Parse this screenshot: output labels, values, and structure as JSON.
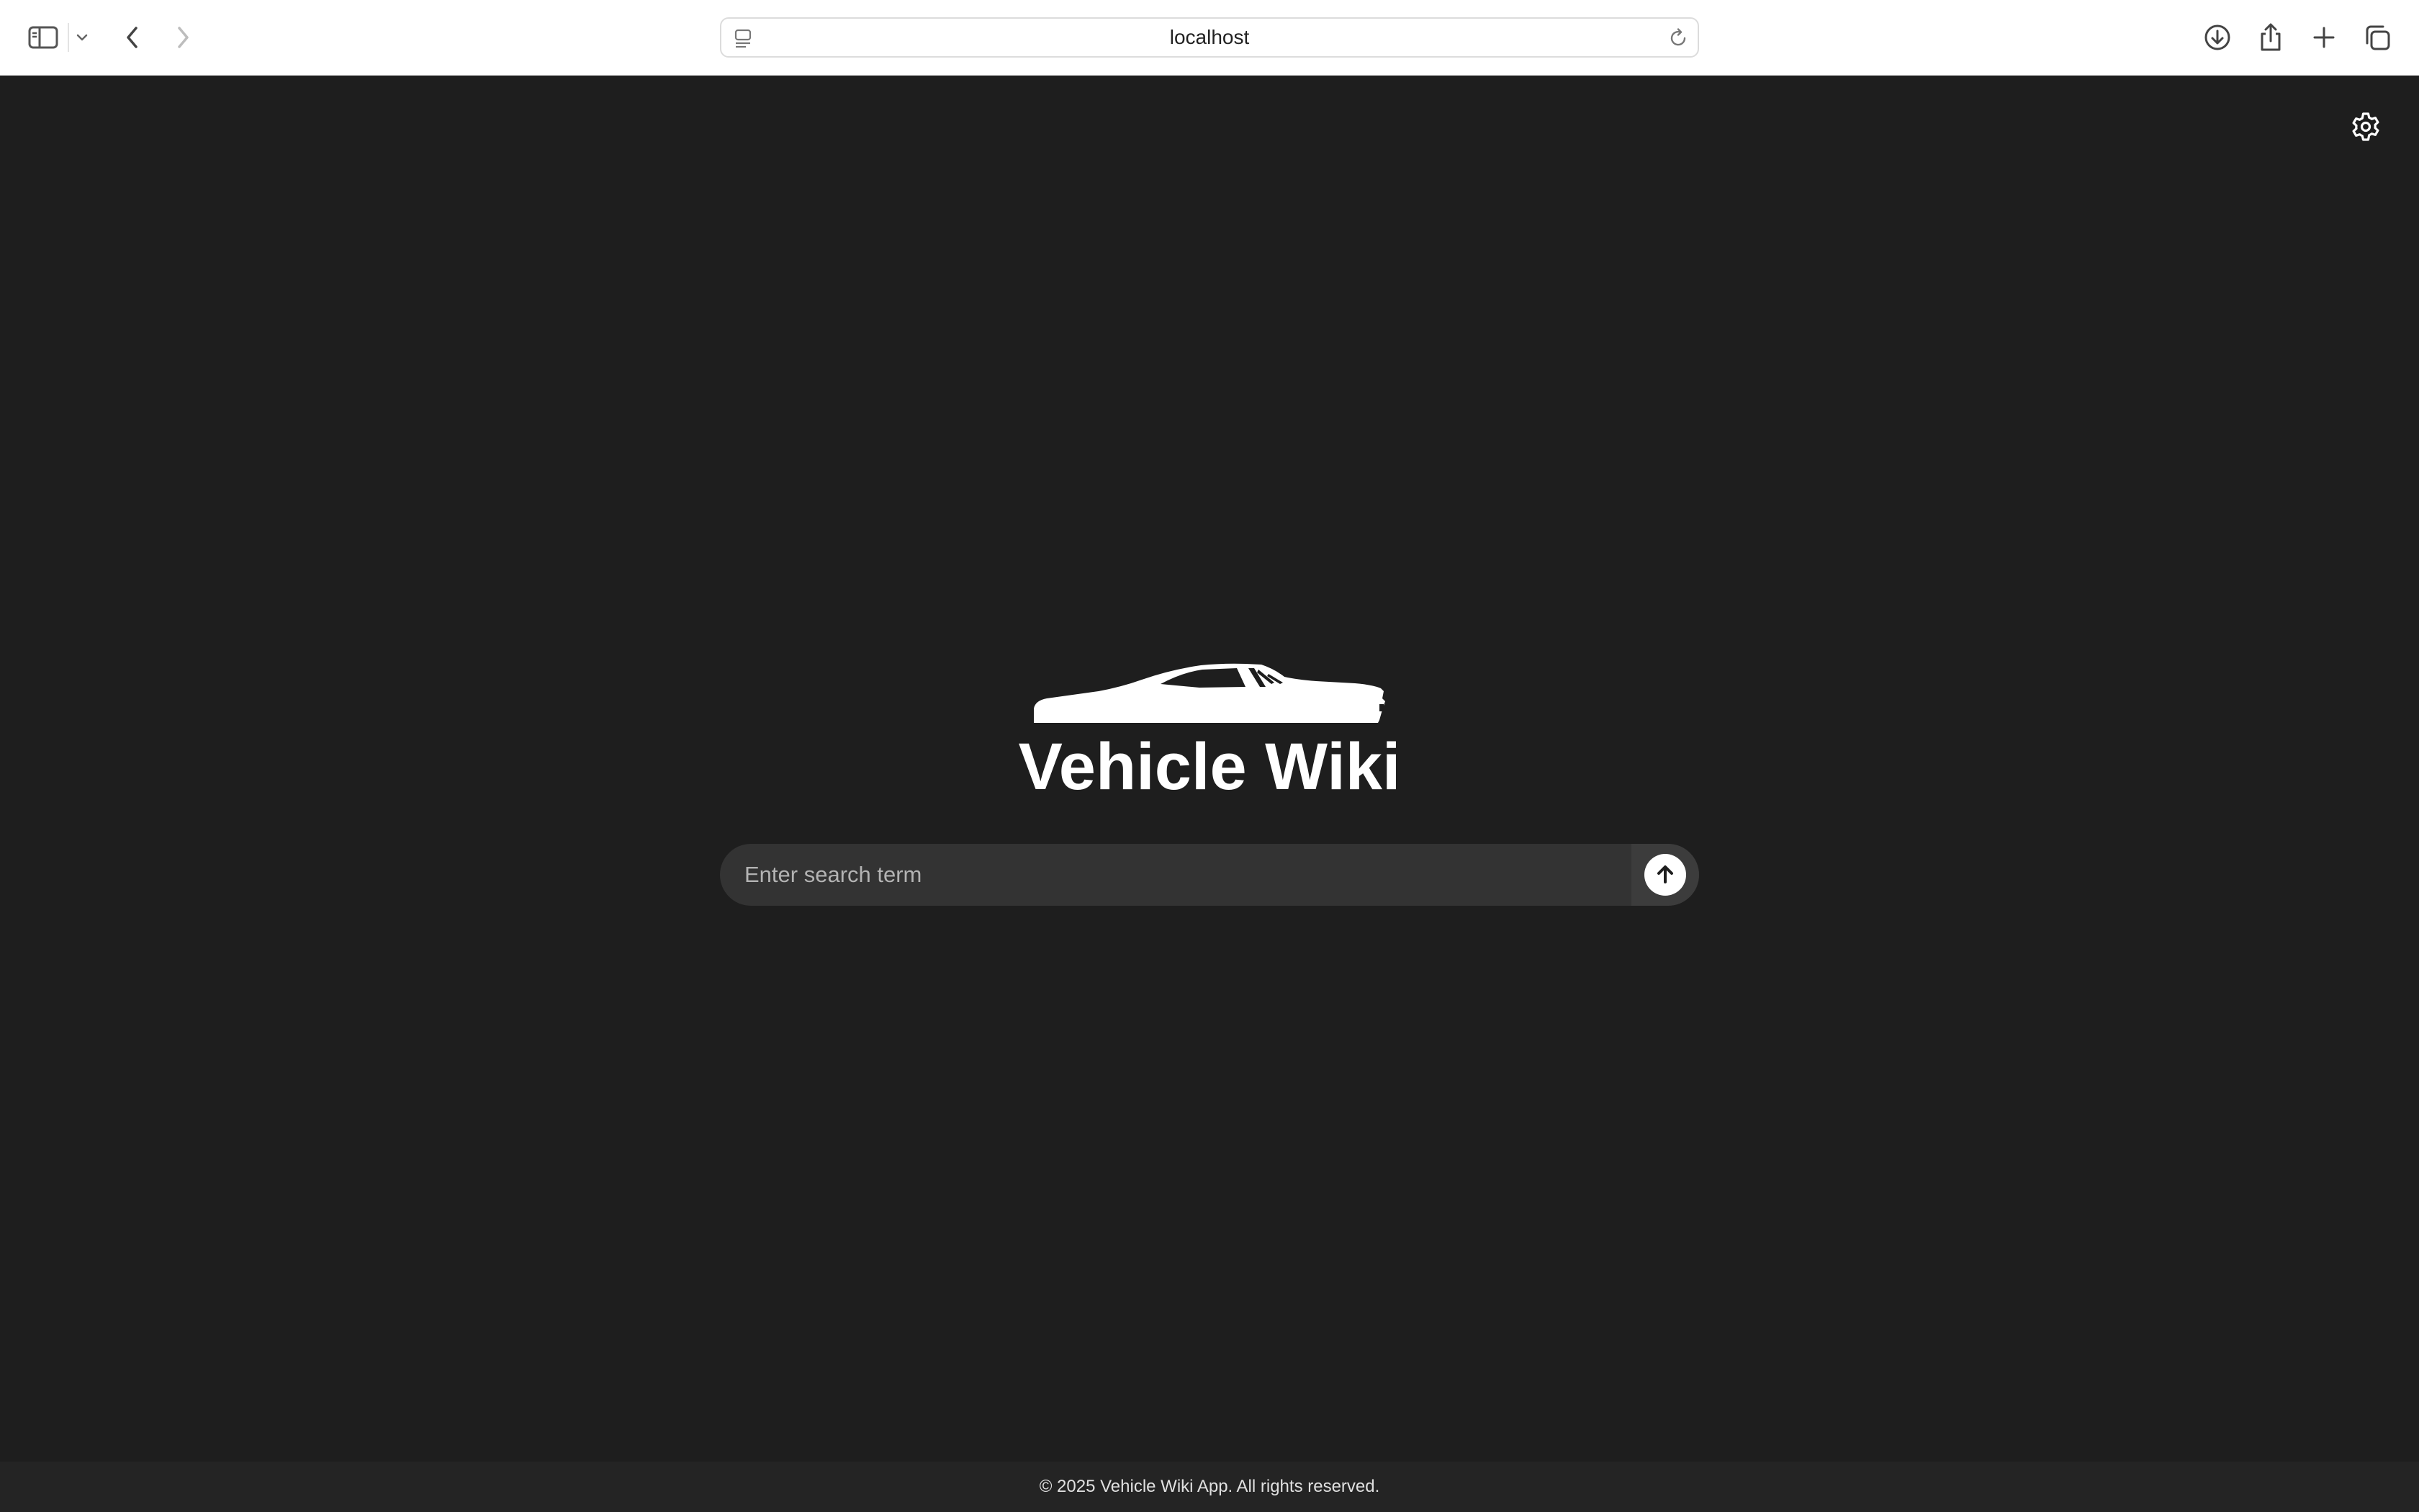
{
  "browser": {
    "url": "localhost",
    "icons": {
      "sidebar": "sidebar-icon",
      "tab_group_menu": "chevron-down-icon",
      "back": "chevron-left-icon",
      "forward": "chevron-right-icon",
      "page_menu": "page-menu-icon",
      "reload": "reload-icon",
      "downloads": "download-icon",
      "share": "share-icon",
      "new_tab": "plus-icon",
      "tab_overview": "tabs-icon"
    }
  },
  "app": {
    "title": "Vehicle Wiki",
    "logo_icon": "car-silhouette-icon",
    "settings_icon": "gear-icon",
    "search": {
      "placeholder": "Enter search term",
      "value": "",
      "submit_icon": "arrow-up-icon"
    },
    "footer": "© 2025 Vehicle Wiki App. All rights reserved."
  },
  "colors": {
    "page_background": "#1e1e1e",
    "search_background": "#333333",
    "footer_background": "#242424",
    "text": "#ffffff"
  }
}
